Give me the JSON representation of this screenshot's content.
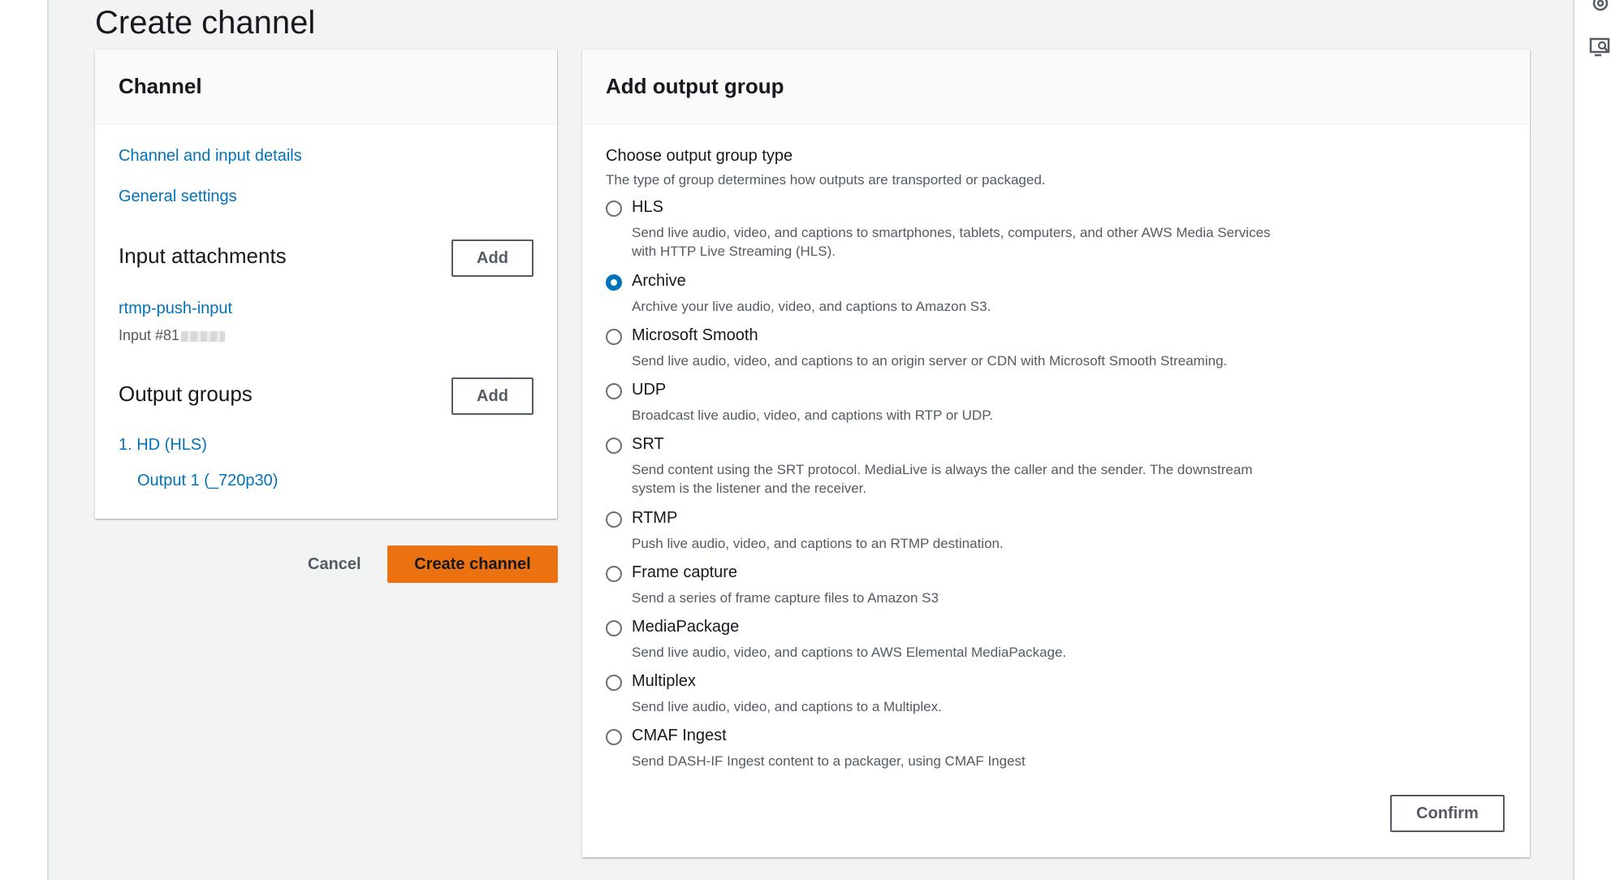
{
  "page": {
    "title": "Create channel"
  },
  "channel_panel": {
    "header": "Channel",
    "nav_links": [
      "Channel and input details",
      "General settings"
    ],
    "input_attachments": {
      "title": "Input attachments",
      "add_label": "Add",
      "input_name": "rtmp-push-input",
      "input_id_prefix": "Input #81"
    },
    "output_groups": {
      "title": "Output groups",
      "add_label": "Add",
      "group_label": "1. HD (HLS)",
      "output_label": "Output 1 (_720p30)"
    }
  },
  "actions": {
    "cancel_label": "Cancel",
    "create_label": "Create channel"
  },
  "output_group_panel": {
    "header": "Add output group",
    "field_label": "Choose output group type",
    "field_description": "The type of group determines how outputs are transported or packaged.",
    "selected": "Archive",
    "options": [
      {
        "label": "HLS",
        "description": "Send live audio, video, and captions to smartphones, tablets, computers, and other AWS Media Services with HTTP Live Streaming (HLS)."
      },
      {
        "label": "Archive",
        "description": "Archive your live audio, video, and captions to Amazon S3."
      },
      {
        "label": "Microsoft Smooth",
        "description": "Send live audio, video, and captions to an origin server or CDN with Microsoft Smooth Streaming."
      },
      {
        "label": "UDP",
        "description": "Broadcast live audio, video, and captions with RTP or UDP."
      },
      {
        "label": "SRT",
        "description": "Send content using the SRT protocol. MediaLive is always the caller and the sender. The downstream system is the listener and the receiver."
      },
      {
        "label": "RTMP",
        "description": "Push live audio, video, and captions to an RTMP destination."
      },
      {
        "label": "Frame capture",
        "description": "Send a series of frame capture files to Amazon S3"
      },
      {
        "label": "MediaPackage",
        "description": "Send live audio, video, and captions to AWS Elemental MediaPackage."
      },
      {
        "label": "Multiplex",
        "description": "Send live audio, video, and captions to a Multiplex."
      },
      {
        "label": "CMAF Ingest",
        "description": "Send DASH-IF Ingest content to a packager, using CMAF Ingest"
      }
    ],
    "confirm_label": "Confirm"
  },
  "right_rail": {
    "icons": [
      "settings-icon",
      "screen-search-icon"
    ]
  },
  "colors": {
    "accent": "#0073bb",
    "primary_button": "#ec7211",
    "background": "#f2f3f3"
  }
}
